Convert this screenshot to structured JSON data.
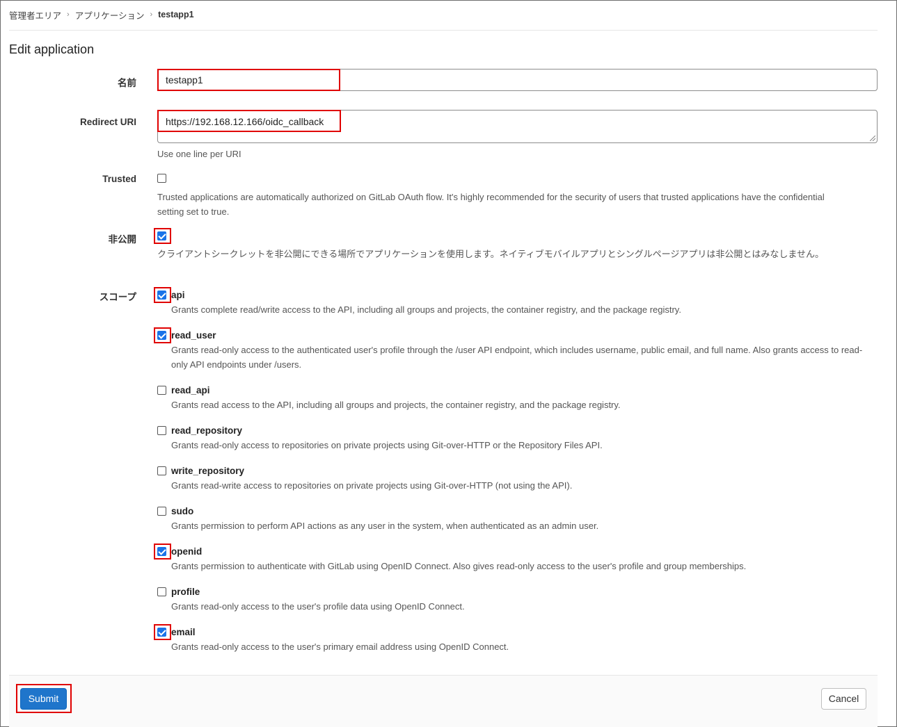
{
  "breadcrumb": {
    "items": [
      "管理者エリア",
      "アプリケーション",
      "testapp1"
    ]
  },
  "page": {
    "title": "Edit application"
  },
  "form": {
    "name": {
      "label": "名前",
      "value": "testapp1"
    },
    "redirect_uri": {
      "label": "Redirect URI",
      "value": "https://192.168.12.166/oidc_callback",
      "help": "Use one line per URI"
    },
    "trusted": {
      "label": "Trusted",
      "checked": false,
      "help": "Trusted applications are automatically authorized on GitLab OAuth flow. It's highly recommended for the security of users that trusted applications have the confidential setting set to true."
    },
    "confidential": {
      "label": "非公開",
      "checked": true,
      "help": "クライアントシークレットを非公開にできる場所でアプリケーションを使用します。ネイティブモバイルアプリとシングルページアプリは非公開とはみなしません。"
    },
    "scopes": {
      "label": "スコープ",
      "items": [
        {
          "name": "api",
          "checked": true,
          "desc": "Grants complete read/write access to the API, including all groups and projects, the container registry, and the package registry."
        },
        {
          "name": "read_user",
          "checked": true,
          "desc": "Grants read-only access to the authenticated user's profile through the /user API endpoint, which includes username, public email, and full name. Also grants access to read-only API endpoints under /users."
        },
        {
          "name": "read_api",
          "checked": false,
          "desc": "Grants read access to the API, including all groups and projects, the container registry, and the package registry."
        },
        {
          "name": "read_repository",
          "checked": false,
          "desc": "Grants read-only access to repositories on private projects using Git-over-HTTP or the Repository Files API."
        },
        {
          "name": "write_repository",
          "checked": false,
          "desc": "Grants read-write access to repositories on private projects using Git-over-HTTP (not using the API)."
        },
        {
          "name": "sudo",
          "checked": false,
          "desc": "Grants permission to perform API actions as any user in the system, when authenticated as an admin user."
        },
        {
          "name": "openid",
          "checked": true,
          "desc": "Grants permission to authenticate with GitLab using OpenID Connect. Also gives read-only access to the user's profile and group memberships."
        },
        {
          "name": "profile",
          "checked": false,
          "desc": "Grants read-only access to the user's profile data using OpenID Connect."
        },
        {
          "name": "email",
          "checked": true,
          "desc": "Grants read-only access to the user's primary email address using OpenID Connect."
        }
      ]
    }
  },
  "actions": {
    "submit_label": "Submit",
    "cancel_label": "Cancel"
  },
  "colors": {
    "accent": "#1f75cb",
    "highlight": "#e00000",
    "checkbox": "#1a73e8"
  }
}
